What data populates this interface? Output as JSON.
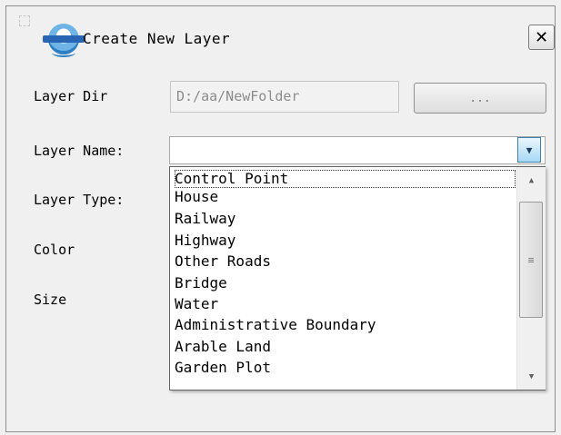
{
  "dialog": {
    "title": "Create New Layer",
    "close_icon": "close-icon",
    "app_icon": "app-logo-icon"
  },
  "form": {
    "layer_dir_label": "Layer Dir",
    "layer_dir_value": "D:/aa/NewFolder",
    "browse_label": "...",
    "layer_name_label": "Layer Name:",
    "layer_name_value": "",
    "layer_type_label": "Layer Type:",
    "color_label": "Color",
    "size_label": "Size"
  },
  "dropdown": {
    "items": [
      "Control Point",
      "House",
      "Railway",
      "Highway",
      "Other Roads",
      "Bridge",
      "Water",
      "Administrative Boundary",
      "Arable Land",
      "Garden Plot"
    ],
    "focused_index": 0
  },
  "colors": {
    "dialog_bg": "#f0f0f0",
    "combo_arrow_bg": "#a7d9f5",
    "dropdown_bg": "#ffffff"
  }
}
